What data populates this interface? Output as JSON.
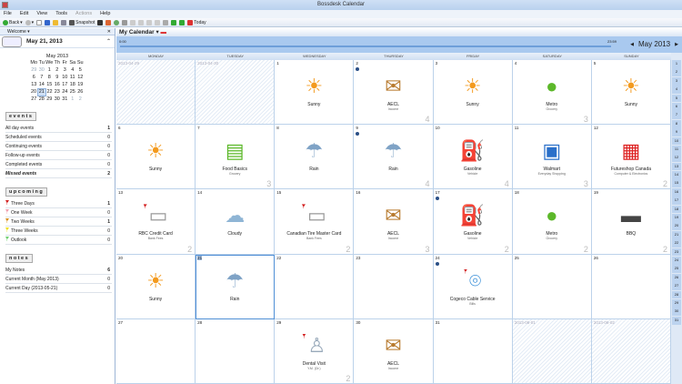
{
  "window": {
    "title": "Bossdesk Calendar"
  },
  "menu": [
    {
      "label": "File"
    },
    {
      "label": "Edit"
    },
    {
      "label": "View"
    },
    {
      "label": "Tools"
    },
    {
      "label": "Actions",
      "disabled": true
    },
    {
      "label": "Help"
    }
  ],
  "toolbar": {
    "back": "Back",
    "snapshot": "Snapshot",
    "today": "Today"
  },
  "left": {
    "welcome": "Welcome",
    "date": "May 21, 2013",
    "mini_calendar": {
      "title": "May 2013",
      "headers": [
        "Mo",
        "Tu",
        "We",
        "Th",
        "Fr",
        "Sa",
        "Su"
      ],
      "weeks": [
        [
          "29",
          "30",
          "1",
          "2",
          "3",
          "4",
          "5"
        ],
        [
          "6",
          "7",
          "8",
          "9",
          "10",
          "11",
          "12"
        ],
        [
          "13",
          "14",
          "15",
          "16",
          "17",
          "18",
          "19"
        ],
        [
          "20",
          "21",
          "22",
          "23",
          "24",
          "25",
          "26"
        ],
        [
          "27",
          "28",
          "29",
          "30",
          "31",
          "1",
          "2"
        ]
      ],
      "selected": "21"
    },
    "events_title": "events",
    "events": [
      {
        "label": "All day events",
        "count": "1"
      },
      {
        "label": "Scheduled events",
        "count": "0"
      },
      {
        "label": "Continuing events",
        "count": "0"
      },
      {
        "label": "Follow-up events",
        "count": "0"
      },
      {
        "label": "Completed events",
        "count": "0"
      },
      {
        "label": "Missed events",
        "count": "2"
      }
    ],
    "upcoming_title": "upcoming",
    "upcoming": [
      {
        "label": "Three Days",
        "count": "1",
        "color": "#d32020"
      },
      {
        "label": "One Week",
        "count": "0",
        "color": "#f0a0b0"
      },
      {
        "label": "Two Weeks",
        "count": "1",
        "color": "#d89020"
      },
      {
        "label": "Three Weeks",
        "count": "0",
        "color": "#f0e020"
      },
      {
        "label": "Outlook",
        "count": "0",
        "color": "#70d070"
      }
    ],
    "notes_title": "notes",
    "notes": [
      {
        "label": "My Notes",
        "count": "6"
      },
      {
        "label": "Current Month (May 2013)",
        "count": "0"
      },
      {
        "label": "Current Day (2013-05-21)",
        "count": "0"
      }
    ]
  },
  "calendar": {
    "name": "My Calendar",
    "time_start": "0:00",
    "time_end": "23:59",
    "month": "May 2013",
    "weekdays": [
      "MONDAY",
      "TUESDAY",
      "WEDNESDAY",
      "THURSDAY",
      "FRIDAY",
      "SATURDAY",
      "SUNDAY"
    ],
    "week_numbers": [
      "1",
      "2",
      "3",
      "4",
      "5",
      "6",
      "7",
      "8",
      "9",
      "10",
      "11",
      "12",
      "13",
      "14",
      "15",
      "16",
      "17",
      "18",
      "19",
      "20",
      "21",
      "22",
      "23",
      "24",
      "25",
      "26",
      "27",
      "28",
      "29",
      "30",
      "31"
    ],
    "cells": [
      {
        "day": "2013-04-29",
        "out": true
      },
      {
        "day": "2013-04-30",
        "out": true
      },
      {
        "day": "1",
        "icon": "sun-icon",
        "title": "Sunny"
      },
      {
        "day": "2",
        "dot": true,
        "icon": "money-envelope-icon",
        "title": "AECL",
        "sub": "Income",
        "count": "4"
      },
      {
        "day": "3",
        "icon": "sun-icon",
        "title": "Sunny"
      },
      {
        "day": "4",
        "icon": "apple-icon",
        "title": "Metro",
        "sub": "Grocery",
        "count": "3"
      },
      {
        "day": "5",
        "icon": "sun-icon",
        "title": "Sunny"
      },
      {
        "day": "6",
        "icon": "sun-icon",
        "title": "Sunny"
      },
      {
        "day": "7",
        "icon": "basket-icon",
        "title": "Food Basics",
        "sub": "Grocery",
        "count": "3"
      },
      {
        "day": "8",
        "icon": "rain-icon",
        "title": "Rain"
      },
      {
        "day": "9",
        "dot": true,
        "icon": "rain-icon",
        "title": "Rain",
        "count": "4"
      },
      {
        "day": "10",
        "icon": "gas-pump-icon",
        "title": "Gasoline",
        "sub": "Vehicle",
        "count": "4"
      },
      {
        "day": "11",
        "icon": "store-icon",
        "title": "Walmart",
        "sub": "Everyday Shopping",
        "count": "3"
      },
      {
        "day": "12",
        "icon": "shop-icon",
        "title": "Futureshop Canada",
        "sub": "Computer & Electronics",
        "count": "2"
      },
      {
        "day": "13",
        "icon": "credit-card-icon",
        "title": "RBC Credit Card",
        "sub": "Bank Fees",
        "count": "2",
        "flag": true
      },
      {
        "day": "14",
        "icon": "cloud-icon",
        "title": "Cloudy"
      },
      {
        "day": "15",
        "icon": "credit-card-icon",
        "title": "Canadian Tire Master Card",
        "sub": "Bank Fees",
        "count": "2",
        "flag": true
      },
      {
        "day": "16",
        "icon": "money-envelope-icon",
        "title": "AECL",
        "sub": "Income",
        "count": "3"
      },
      {
        "day": "17",
        "dot": true,
        "icon": "gas-pump-icon",
        "title": "Gasoline",
        "sub": "Vehicle",
        "count": "2"
      },
      {
        "day": "18",
        "icon": "apple-icon",
        "title": "Metro",
        "sub": "Grocery",
        "count": "2"
      },
      {
        "day": "19",
        "icon": "bbq-icon",
        "title": "BBQ",
        "count": "2"
      },
      {
        "day": "20",
        "icon": "sun-icon",
        "title": "Sunny"
      },
      {
        "day": "21",
        "today": true,
        "icon": "rain-icon",
        "title": "Rain"
      },
      {
        "day": "22"
      },
      {
        "day": "23"
      },
      {
        "day": "24",
        "dot": true,
        "icon": "satellite-icon",
        "title": "Cogeco Cable Service",
        "sub": "Bills",
        "flag": true
      },
      {
        "day": "25"
      },
      {
        "day": "26"
      },
      {
        "day": "27"
      },
      {
        "day": "28"
      },
      {
        "day": "29",
        "icon": "tooth-icon",
        "title": "Dental Visit",
        "sub": "Y.M. (Dr.)",
        "count": "2",
        "flag": true
      },
      {
        "day": "30",
        "icon": "money-envelope-icon",
        "title": "AECL",
        "sub": "Income"
      },
      {
        "day": "31"
      },
      {
        "day": "2013-06-01",
        "out": true
      },
      {
        "day": "2013-06-02",
        "out": true
      }
    ]
  }
}
